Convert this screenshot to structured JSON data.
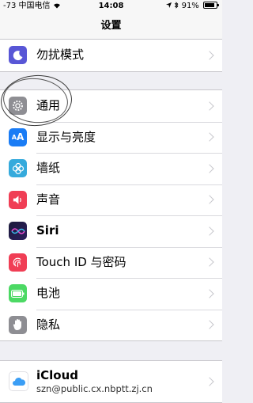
{
  "status": {
    "signal": "-73",
    "carrier": "中国电信",
    "time": "14:08",
    "battery": "91%"
  },
  "nav": {
    "title": "设置"
  },
  "groups": [
    {
      "items": [
        {
          "label": "勿扰模式",
          "icon": "moon-icon",
          "color": "#5856d6"
        }
      ]
    },
    {
      "items": [
        {
          "label": "通用",
          "icon": "gear-icon",
          "color": "#8e8e93"
        },
        {
          "label": "显示与亮度",
          "icon": "text-size-icon",
          "color": "#1a7cf5"
        },
        {
          "label": "墙纸",
          "icon": "flower-icon",
          "color": "#35aadc"
        },
        {
          "label": "声音",
          "icon": "speaker-icon",
          "color": "#f03e55"
        },
        {
          "label": "Siri",
          "icon": "siri-icon",
          "color": "#1a1a2e"
        },
        {
          "label": "Touch ID 与密码",
          "icon": "fingerprint-icon",
          "color": "#f03e55"
        },
        {
          "label": "电池",
          "icon": "battery-icon",
          "color": "#4cd964"
        },
        {
          "label": "隐私",
          "icon": "hand-icon",
          "color": "#8e8e93"
        }
      ]
    },
    {
      "items": [
        {
          "label": "iCloud",
          "sublabel": "szn@public.cx.nbptt.zj.cn",
          "icon": "cloud-icon",
          "color": "#ffffff"
        }
      ]
    }
  ]
}
